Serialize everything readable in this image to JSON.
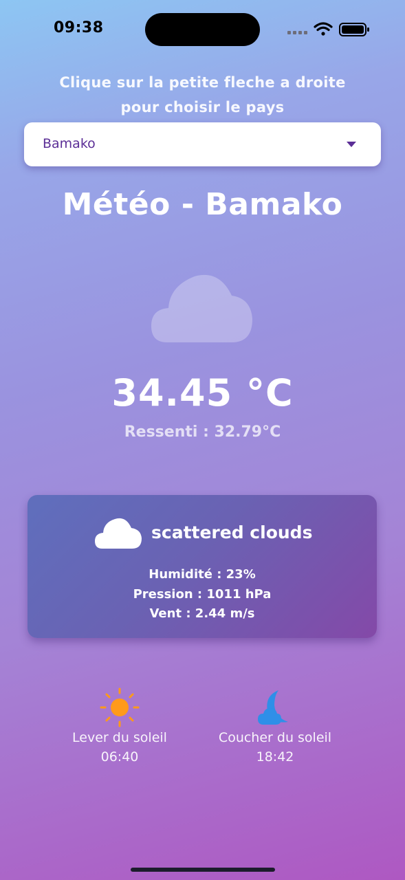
{
  "status_bar": {
    "time": "09:38"
  },
  "instruction": {
    "line1": "Clique sur la petite fleche a droite",
    "line2": "pour choisir le pays"
  },
  "dropdown": {
    "selected": "Bamako",
    "icon": "caret-down-icon",
    "text_color": "#5b2e96"
  },
  "weather": {
    "title": "Météo - Bamako",
    "icon": "cloud-icon",
    "temperature": "34.45 °C",
    "feels_like": "Ressenti : 32.79°C"
  },
  "details_card": {
    "icon": "cloud-icon",
    "description": "scattered clouds",
    "humidity": "Humidité : 23%",
    "pressure": "Pression : 1011 hPa",
    "wind": "Vent : 2.44 m/s"
  },
  "sun": {
    "sunrise_label": "Lever du soleil",
    "sunrise_time": "06:40",
    "sunrise_icon": "sun-icon",
    "sunrise_color": "#ff9a1a",
    "sunset_label": "Coucher du soleil",
    "sunset_time": "18:42",
    "sunset_icon": "moon-cloud-icon",
    "sunset_color": "#2f8fe8"
  }
}
